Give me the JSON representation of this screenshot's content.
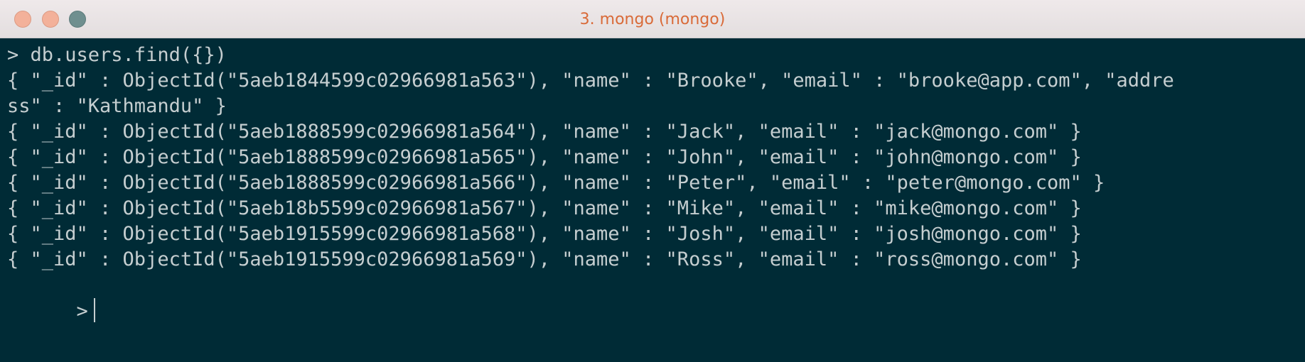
{
  "window": {
    "title": "3. mongo (mongo)"
  },
  "terminal": {
    "lines": [
      "> db.users.find({})",
      "{ \"_id\" : ObjectId(\"5aeb1844599c02966981a563\"), \"name\" : \"Brooke\", \"email\" : \"brooke@app.com\", \"addre",
      "ss\" : \"Kathmandu\" }",
      "{ \"_id\" : ObjectId(\"5aeb1888599c02966981a564\"), \"name\" : \"Jack\", \"email\" : \"jack@mongo.com\" }",
      "{ \"_id\" : ObjectId(\"5aeb1888599c02966981a565\"), \"name\" : \"John\", \"email\" : \"john@mongo.com\" }",
      "{ \"_id\" : ObjectId(\"5aeb1888599c02966981a566\"), \"name\" : \"Peter\", \"email\" : \"peter@mongo.com\" }",
      "{ \"_id\" : ObjectId(\"5aeb18b5599c02966981a567\"), \"name\" : \"Mike\", \"email\" : \"mike@mongo.com\" }",
      "{ \"_id\" : ObjectId(\"5aeb1915599c02966981a568\"), \"name\" : \"Josh\", \"email\" : \"josh@mongo.com\" }",
      "{ \"_id\" : ObjectId(\"5aeb1915599c02966981a569\"), \"name\" : \"Ross\", \"email\" : \"ross@mongo.com\" }"
    ],
    "prompt": ">"
  },
  "colors": {
    "terminal_background": "#002b36",
    "terminal_text": "#c5ced0",
    "title_text": "#d96a38"
  }
}
